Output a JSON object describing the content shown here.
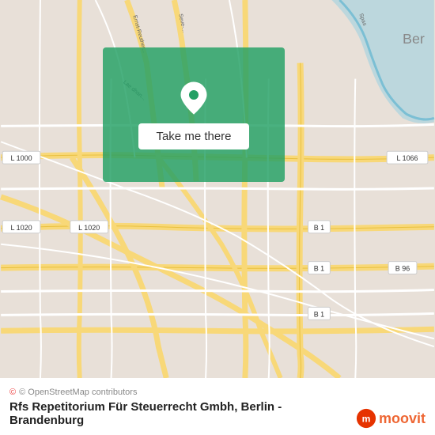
{
  "map": {
    "background_color": "#e8e0d8",
    "highlight_color": "#22a064"
  },
  "overlay": {
    "button_label": "Take me there",
    "pin_icon": "location-pin"
  },
  "footer": {
    "copyright": "© OpenStreetMap contributors",
    "place_name": "Rfs Repetitorium Für Steuerrecht Gmbh, Berlin -",
    "place_region": "Brandenburg",
    "brand": "moovit"
  },
  "road_labels": {
    "l1000": "L 1000",
    "l1020": "L 1020",
    "l1066": "L 1066",
    "b1": "B 1",
    "b96": "B 96"
  }
}
